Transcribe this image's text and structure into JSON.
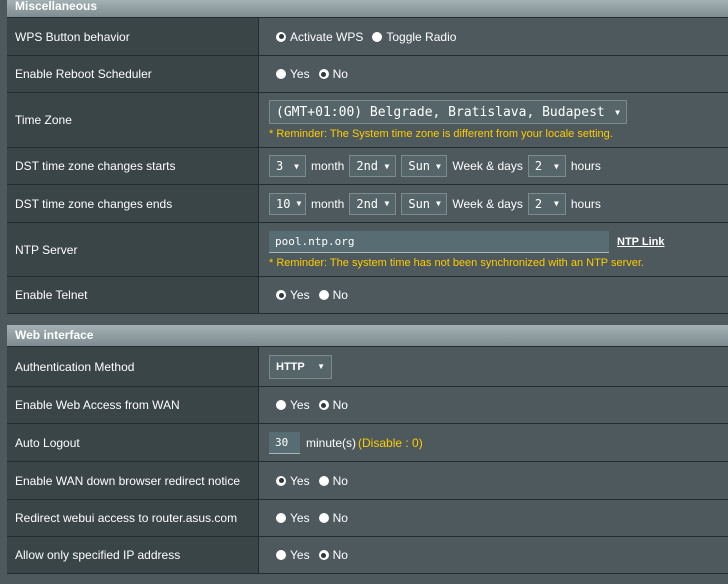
{
  "misc": {
    "title": "Miscellaneous",
    "wps": {
      "label": "WPS Button behavior",
      "opt1": "Activate WPS",
      "opt2": "Toggle Radio",
      "selected": "Activate WPS"
    },
    "reboot": {
      "label": "Enable Reboot Scheduler",
      "yes": "Yes",
      "no": "No",
      "selected": "No"
    },
    "timezone": {
      "label": "Time Zone",
      "value": "(GMT+01:00) Belgrade, Bratislava, Budapest",
      "reminder": "* Reminder: The System time zone is different from your locale setting."
    },
    "dst_start": {
      "label": "DST time zone changes starts",
      "month": "3",
      "month_text": "month",
      "week": "2nd",
      "day": "Sun",
      "weekdays_text": "Week & days",
      "hour": "2",
      "hours_text": "hours"
    },
    "dst_end": {
      "label": "DST time zone changes ends",
      "month": "10",
      "month_text": "month",
      "week": "2nd",
      "day": "Sun",
      "weekdays_text": "Week & days",
      "hour": "2",
      "hours_text": "hours"
    },
    "ntp": {
      "label": "NTP Server",
      "value": "pool.ntp.org",
      "link": "NTP Link",
      "reminder": "* Reminder: The system time has not been synchronized with an NTP server."
    },
    "telnet": {
      "label": "Enable Telnet",
      "yes": "Yes",
      "no": "No",
      "selected": "Yes"
    }
  },
  "web": {
    "title": "Web interface",
    "auth": {
      "label": "Authentication Method",
      "value": "HTTP"
    },
    "wan_access": {
      "label": "Enable Web Access from WAN",
      "yes": "Yes",
      "no": "No",
      "selected": "No"
    },
    "auto_logout": {
      "label": "Auto Logout",
      "value": "30",
      "unit": "minute(s)",
      "hint": "(Disable : 0)"
    },
    "wan_redirect": {
      "label": "Enable WAN down browser redirect notice",
      "yes": "Yes",
      "no": "No",
      "selected": "Yes"
    },
    "redirect_webui": {
      "label": "Redirect webui access to router.asus.com",
      "yes": "Yes",
      "no": "No",
      "selected": "No"
    },
    "allow_ip": {
      "label": "Allow only specified IP address",
      "yes": "Yes",
      "no": "No",
      "selected": "No"
    }
  },
  "colors": {
    "reminder": "#ffcc00",
    "label_bg": "#3a4548",
    "value_bg": "#4d595d",
    "header_bg": "#92a0a5"
  },
  "icons": {
    "dropdown": "triangle-down"
  }
}
